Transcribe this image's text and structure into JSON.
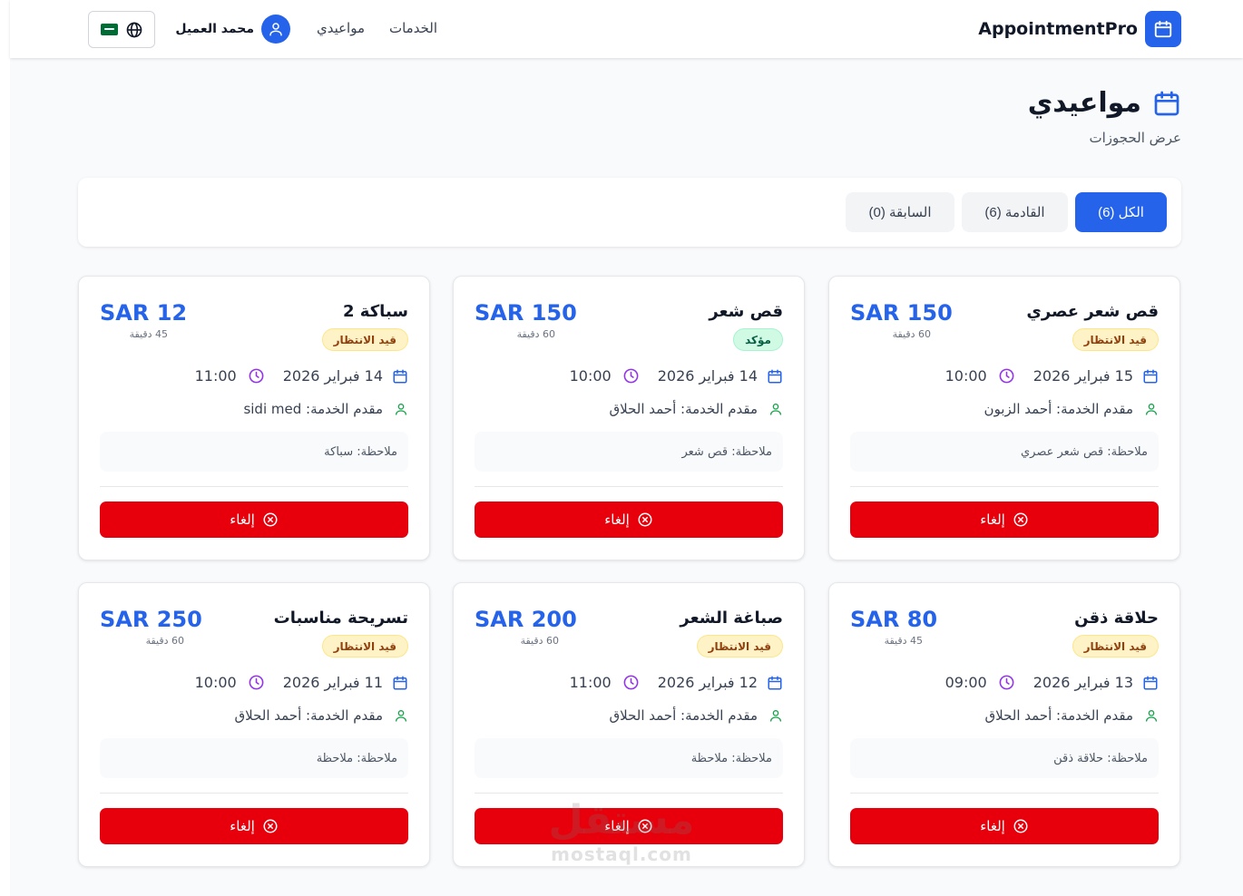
{
  "header": {
    "brand": "AppointmentPro",
    "nav": {
      "services": "الخدمات",
      "appointments": "مواعيدي"
    },
    "user_name": "محمد العميل"
  },
  "page": {
    "title": "مواعيدي",
    "subtitle": "عرض الحجوزات"
  },
  "tabs": {
    "all": "الكل (6)",
    "upcoming": "القادمة (6)",
    "past": "السابقة (0)",
    "active": "all"
  },
  "colors": {
    "accent": "#2563eb",
    "danger": "#e7000b",
    "pending_bg": "#fef3c7",
    "confirmed_bg": "#d1fae5",
    "date_icon": "#2563eb",
    "time_icon": "#9333ea",
    "provider_icon": "#16a34a"
  },
  "cards": [
    {
      "title": "قص شعر عصري",
      "status": "قيد الانتظار",
      "price": "SAR 150",
      "duration": "60 دقيقة",
      "date": "15 فبراير 2026",
      "time": "10:00",
      "provider": "مقدم الخدمة: أحمد الزبون",
      "note": "ملاحظة: قص شعر عصري",
      "cancel": "إلغاء"
    },
    {
      "title": "قص شعر",
      "status": "مؤكد",
      "price": "SAR 150",
      "duration": "60 دقيقة",
      "date": "14 فبراير 2026",
      "time": "10:00",
      "provider": "مقدم الخدمة: أحمد الحلاق",
      "note": "ملاحظة: قص شعر",
      "cancel": "إلغاء"
    },
    {
      "title": "سباكة 2",
      "status": "قيد الانتظار",
      "price": "SAR 12",
      "duration": "45 دقيقة",
      "date": "14 فبراير 2026",
      "time": "11:00",
      "provider": "مقدم الخدمة: sidi med",
      "note": "ملاحظة: سباكة",
      "cancel": "إلغاء"
    },
    {
      "title": "حلاقة ذقن",
      "status": "قيد الانتظار",
      "price": "SAR 80",
      "duration": "45 دقيقة",
      "date": "13 فبراير 2026",
      "time": "09:00",
      "provider": "مقدم الخدمة: أحمد الحلاق",
      "note": "ملاحظة: حلاقة ذقن",
      "cancel": "إلغاء"
    },
    {
      "title": "صباغة الشعر",
      "status": "قيد الانتظار",
      "price": "SAR 200",
      "duration": "60 دقيقة",
      "date": "12 فبراير 2026",
      "time": "11:00",
      "provider": "مقدم الخدمة: أحمد الحلاق",
      "note": "ملاحظة: ملاحظة",
      "cancel": "إلغاء"
    },
    {
      "title": "تسريحة مناسبات",
      "status": "قيد الانتظار",
      "price": "SAR 250",
      "duration": "60 دقيقة",
      "date": "11 فبراير 2026",
      "time": "10:00",
      "provider": "مقدم الخدمة: أحمد الحلاق",
      "note": "ملاحظة: ملاحظة",
      "cancel": "إلغاء"
    }
  ],
  "watermark": {
    "ar": "مستقل",
    "en": "mostaql.com"
  }
}
